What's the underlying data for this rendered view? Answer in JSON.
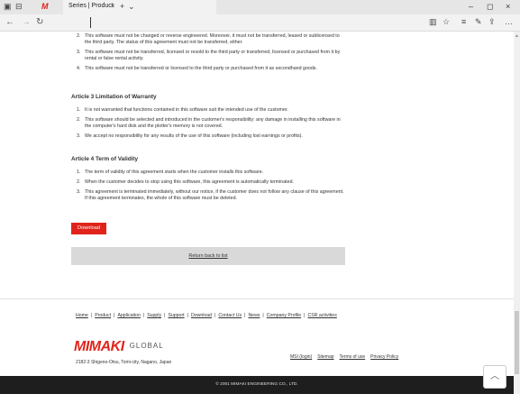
{
  "browser": {
    "tab_title": "Series | Product",
    "tab_close": "×",
    "back": "←",
    "forward": "→",
    "refresh": "↻",
    "win_min": "–",
    "win_max": "◻",
    "win_close": "×"
  },
  "article_prev": {
    "items": [
      {
        "num": "2.",
        "text": "This software must not be changed or reverse engineered. Moreover, it must not be transferred, leased or sublicensed to the third party. The status of this agreement must not be transferred, either."
      },
      {
        "num": "3.",
        "text": "This software must not be transferred, licensed or resold to the third party or transferred, licensed or purchased from it by rental or false rental activity."
      },
      {
        "num": "4.",
        "text": "This software must not be transferred or licensed to the third party or purchased from it as secondhand goods."
      }
    ]
  },
  "article3": {
    "title": "Article 3 Limitation of Warranty",
    "items": [
      {
        "num": "1.",
        "text": "It is not warranted that functions contained in this software suit the intended use of the customer."
      },
      {
        "num": "2.",
        "text": "This software should be selected and introduced in the customer's responsibility: any damage in installing this software in the computer's hard disk and the plotter's memory is not covered."
      },
      {
        "num": "3.",
        "text": "We accept no responsibility for any results of the use of this software (including lost earnings or profits)."
      }
    ]
  },
  "article4": {
    "title": "Article 4 Term of Validity",
    "items": [
      {
        "num": "1.",
        "text": "The term of validity of this agreement starts when the customer installs this software."
      },
      {
        "num": "2.",
        "text": "When the customer decides to stop using this software, this agreement is automatically terminated."
      },
      {
        "num": "3.",
        "text": "This agreement is terminated immediately, without our notice, if the customer does not follow any clause of this agreement. If this agreement terminates, the whole of this software must be deleted."
      }
    ]
  },
  "download_label": "Download",
  "return_label": "Return back to list",
  "footer": {
    "nav": [
      "Home",
      "Product",
      "Application",
      "Supply",
      "Support",
      "Download",
      "Contact Us",
      "News",
      "Company Profile",
      "CSR activities"
    ],
    "brand": "MIMAKI",
    "global": "GLOBAL",
    "address": "2182-3 Shigeno-Otsu, Tomi-city, Nagano, Japan",
    "msi": "MSI (login)",
    "sitemap": "Sitemap",
    "terms": "Terms of use",
    "privacy": "Privacy Policy",
    "copyright": "© 2001 MIMAKI ENGINEERING CO., LTD."
  }
}
